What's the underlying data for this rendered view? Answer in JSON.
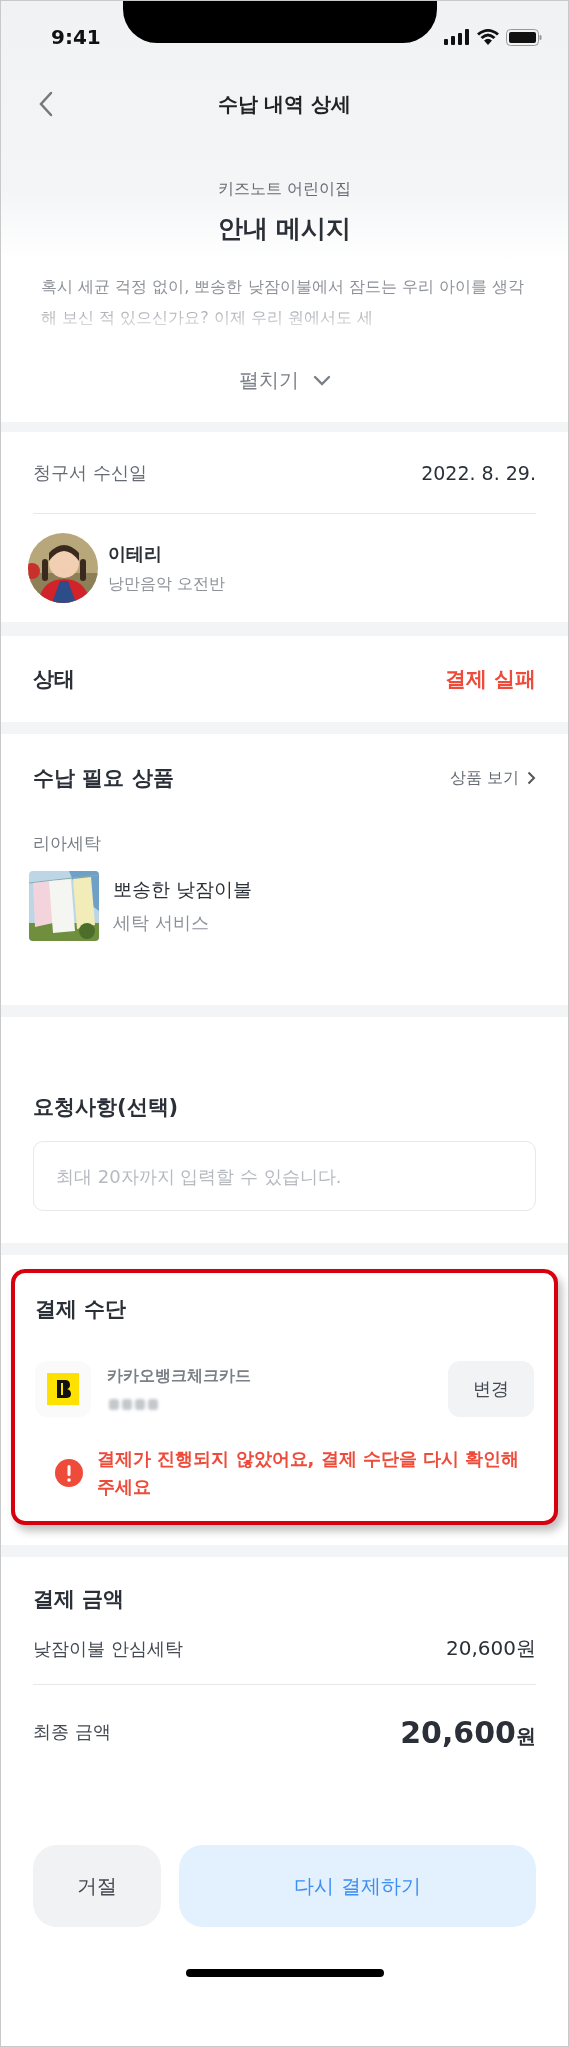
{
  "status_bar": {
    "time": "9:41"
  },
  "header": {
    "title": "수납 내역 상세"
  },
  "notice": {
    "sender": "키즈노트 어린이집",
    "title": "안내 메시지",
    "body": "혹시 세균 걱정 없이, 뽀송한 낮잠이불에서 잠드는 우리 아이를 생각해 보신 적 있으신가요? 이제 우리 원에서도 세",
    "expanded": false,
    "toggle_label": "펼치기"
  },
  "invoice": {
    "label": "청구서 수신일",
    "date": "2022. 8. 29."
  },
  "child": {
    "name": "이테리",
    "class": "낭만음악 오전반"
  },
  "status": {
    "label": "상태",
    "value": "결제 실패",
    "failed": true
  },
  "products": {
    "title": "수납 필요 상품",
    "link": "상품 보기",
    "vendor": "리아세탁",
    "items": [
      {
        "name": "뽀송한 낮잠이불",
        "category": "세탁 서비스"
      }
    ]
  },
  "request": {
    "title": "요청사항(선택)",
    "placeholder": "최대 20자까지 입력할 수 있습니다."
  },
  "payment_method": {
    "title": "결제 수단",
    "highlighted": true,
    "card_name": "카카오뱅크체크카드",
    "card_number_masked": true,
    "change_button": "변경",
    "error": "결제가 진행되지 않았어요, 결제 수단을 다시 확인해 주세요"
  },
  "amount": {
    "title": "결제 금액",
    "rows": [
      {
        "kind": "item",
        "label": "낮잠이불 안심세탁",
        "value": "20,600",
        "unit": "원"
      },
      {
        "kind": "total",
        "label": "최종 금액",
        "value": "20,600",
        "unit": "원"
      }
    ]
  },
  "actions": [
    {
      "kind": "secondary",
      "label": "거절"
    },
    {
      "kind": "primary",
      "label": "다시 결제하기"
    }
  ]
}
